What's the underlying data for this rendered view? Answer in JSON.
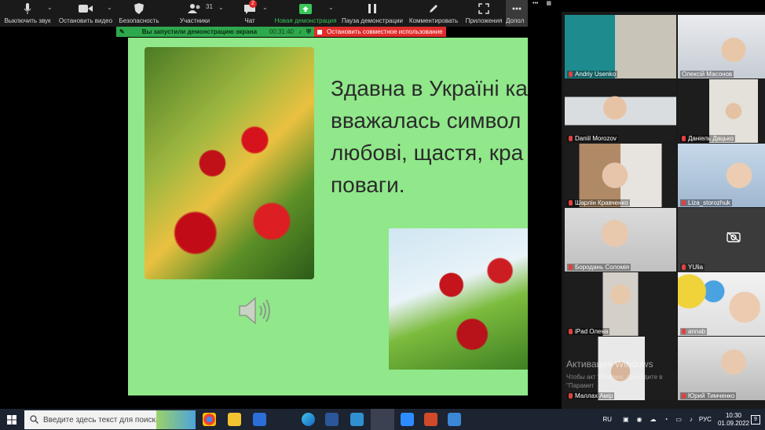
{
  "toolbar": {
    "items": [
      {
        "label": "Выключить звук",
        "icon": "microphone-icon"
      },
      {
        "label": "Остановить видео",
        "icon": "video-camera-icon"
      },
      {
        "label": "Безопасность",
        "icon": "shield-icon"
      },
      {
        "label": "Участники",
        "icon": "participants-icon",
        "count": "31"
      },
      {
        "label": "Чат",
        "icon": "chat-icon",
        "badge": "2"
      },
      {
        "label": "Новая демонстрация",
        "icon": "share-screen-icon"
      },
      {
        "label": "Пауза демонстрации",
        "icon": "pause-icon"
      },
      {
        "label": "Комментировать",
        "icon": "pen-icon"
      },
      {
        "label": "Приложения",
        "icon": "apps-icon"
      },
      {
        "label": "Допол",
        "icon": "more-icon"
      }
    ]
  },
  "share_bar": {
    "text": "Вы запустили демонстрацию экрана",
    "timer": "00:31:40",
    "stop_label": "Остановить совместное использование"
  },
  "slide": {
    "lines": [
      "Здавна в Україні ка",
      "вважалась символ",
      "любові, щастя, кра",
      "поваги."
    ]
  },
  "participants": [
    {
      "name": "Andriy Usenko"
    },
    {
      "name": "Олексій Масонов"
    },
    {
      "name": "Daniil Morozov"
    },
    {
      "name": "Даніель Дацько"
    },
    {
      "name": "Шарлін Кравченко"
    },
    {
      "name": "Liza_storozhuk"
    },
    {
      "name": "Бородань Соломія"
    },
    {
      "name": "YUlia"
    },
    {
      "name": "iPad Олена"
    },
    {
      "name": "annab"
    },
    {
      "name": "Маллах Амір"
    },
    {
      "name": "Юрий Тимченко"
    }
  ],
  "watermark": {
    "title": "Активация Windows",
    "line1": "Чтобы акт              Windows, перейдите в",
    "line2": "\"Парамет"
  },
  "taskbar": {
    "search_placeholder": "Введите здесь текст для поиска",
    "lang": "RU",
    "lang2": "РУС",
    "time": "10:30",
    "date": "01.09.2022",
    "notification_count": "9"
  },
  "colors": {
    "slide_bg": "#90e88a",
    "share_green": "#2ea84c",
    "stop_red": "#e12c2c",
    "zoom_green": "#37c65a"
  }
}
